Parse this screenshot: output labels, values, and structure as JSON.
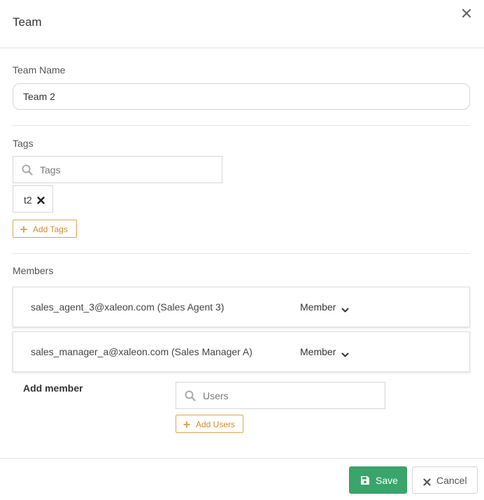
{
  "modal": {
    "title": "Team",
    "close_icon": "close-icon"
  },
  "team_name": {
    "label": "Team Name",
    "value": "Team 2"
  },
  "tags": {
    "label": "Tags",
    "search_placeholder": "Tags",
    "items": [
      {
        "label": "t2"
      }
    ],
    "add_button_label": "Add Tags"
  },
  "members": {
    "label": "Members",
    "rows": [
      {
        "email": "sales_agent_3@xaleon.com (Sales Agent 3)",
        "role": "Member"
      },
      {
        "email": "sales_manager_a@xaleon.com (Sales Manager A)",
        "role": "Member"
      }
    ],
    "add_member_label": "Add member",
    "users_placeholder": "Users",
    "add_users_label": "Add Users"
  },
  "footer": {
    "save_label": "Save",
    "cancel_label": "Cancel"
  },
  "colors": {
    "accent_orange": "#e4a34b",
    "save_green": "#3aa56b"
  }
}
